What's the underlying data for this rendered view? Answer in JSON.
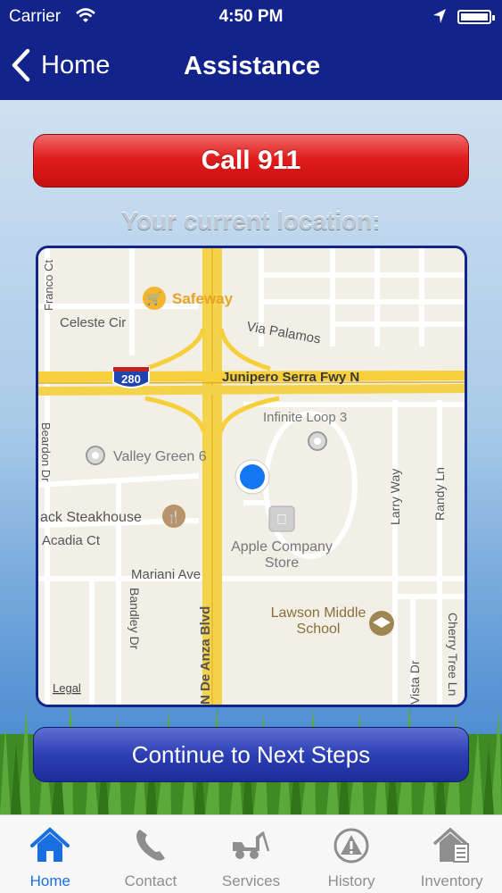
{
  "status_bar": {
    "carrier": "Carrier",
    "time": "4:50 PM"
  },
  "nav": {
    "back_label": "Home",
    "title": "Assistance"
  },
  "main": {
    "call_button_label": "Call 911",
    "location_label": "Your current location:",
    "continue_button_label": "Continue to Next Steps"
  },
  "map": {
    "labels": {
      "franco": "Franco Ct",
      "safeway": "Safeway",
      "celeste": "Celeste Cir",
      "via_palamos": "Via Palamos",
      "freeway": "Junipero Serra Fwy N",
      "shield": "280",
      "infinite_loop": "Infinite Loop 3",
      "valley_green": "Valley Green 6",
      "beardon": "Beardon Dr",
      "steakhouse": "ack Steakhouse",
      "acadia": "Acadia Ct",
      "apple_store_line1": "Apple Company",
      "apple_store_line2": "Store",
      "mariani": "Mariani Ave",
      "bandley": "Bandley Dr",
      "de_anza": "N De Anza Blvd",
      "lawson_line1": "Lawson Middle",
      "lawson_line2": "School",
      "larry": "Larry Way",
      "randy": "Randy Ln",
      "vista": "Vista Dr",
      "cherry": "Cherry Tree Ln",
      "legal": "Legal"
    }
  },
  "tabs": [
    {
      "label": "Home",
      "icon": "home-icon",
      "active": true
    },
    {
      "label": "Contact",
      "icon": "phone-icon",
      "active": false
    },
    {
      "label": "Services",
      "icon": "tow-truck-icon",
      "active": false
    },
    {
      "label": "History",
      "icon": "warning-history-icon",
      "active": false
    },
    {
      "label": "Inventory",
      "icon": "house-inventory-icon",
      "active": false
    }
  ],
  "colors": {
    "header": "#13238c",
    "call_button": "#e11d1d",
    "continue_button": "#2c3fb4",
    "active_tab": "#1a6fe0",
    "inactive_tab": "#8e8e8e"
  }
}
